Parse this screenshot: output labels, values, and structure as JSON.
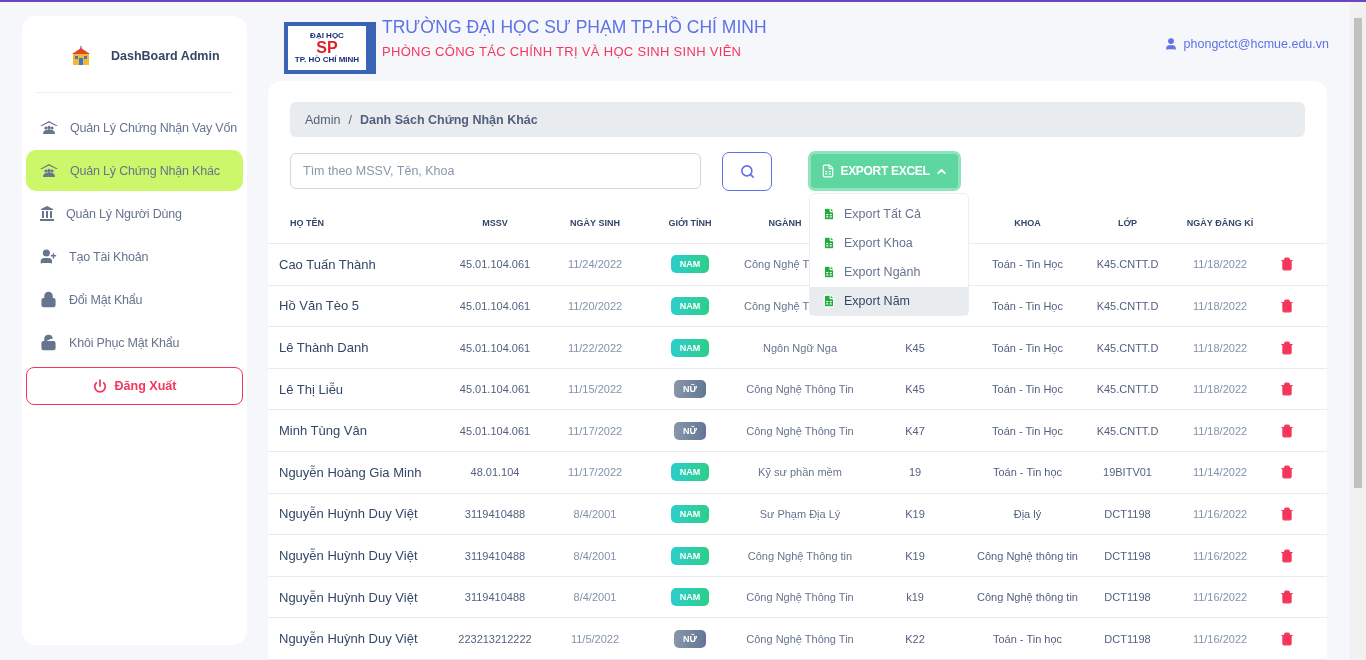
{
  "sidebar": {
    "title": "DashBoard Admin",
    "items": [
      {
        "label": "Quản Lý Chứng Nhận Vay Vốn",
        "kind": "roof",
        "selected": false
      },
      {
        "label": "Quản Lý Chứng Nhận Khác",
        "kind": "roof",
        "selected": true
      },
      {
        "label": "Quản Lý Người Dùng",
        "kind": "building",
        "selected": false
      },
      {
        "label": "Tạo Tài Khoản",
        "kind": "add-user",
        "selected": false
      },
      {
        "label": "Đổi Mật Khẩu",
        "kind": "lock",
        "selected": false
      },
      {
        "label": "Khôi Phục Mật Khẩu",
        "kind": "unlock",
        "selected": false
      }
    ],
    "logout": "Đăng Xuất"
  },
  "header": {
    "logo": {
      "top": "ĐẠI HỌC",
      "main": "SP",
      "bottom": "TP. HỒ CHÍ MINH"
    },
    "title": "TRƯỜNG ĐẠI HỌC SƯ PHẠM TP.HỒ CHÍ MINH",
    "subtitle": "PHÒNG CÔNG TÁC CHÍNH TRỊ VÀ HỌC SINH SINH VIÊN",
    "user": "phongctct@hcmue.edu.vn"
  },
  "breadcrumb": [
    "Admin",
    "/",
    "Danh Sách Chứng Nhận Khác"
  ],
  "search": {
    "placeholder": "Tìm theo MSSV, Tên, Khoa"
  },
  "export": {
    "label": "EXPORT EXCEL",
    "expanded": true,
    "items": [
      {
        "label": "Export Tất Cả",
        "selected": false
      },
      {
        "label": "Export Khoa",
        "selected": false
      },
      {
        "label": "Export Ngành",
        "selected": false
      },
      {
        "label": "Export Năm",
        "selected": true
      }
    ]
  },
  "table": {
    "columns": {
      "name": "HỌ TÊN",
      "mssv": "MSSV",
      "dob": "NGÀY SINH",
      "gender": "GIỚI TÍNH",
      "major": "NGÀNH",
      "faculty": "KHOA",
      "class": "LỚP",
      "registered": "NGÀY ĐĂNG KÍ"
    },
    "rows": [
      {
        "name": "Cao Tuấn Thành",
        "mssv": "45.01.104.061",
        "dob": "11/24/2022",
        "gender": {
          "label": "NAM",
          "kind": "male"
        },
        "major": "Công Nghệ T",
        "faculty": "Toán - Tin Học",
        "class": "K45.CNTT.D",
        "registered": "11/18/2022"
      },
      {
        "name": "Hồ Văn Tèo 5",
        "mssv": "45.01.104.061",
        "dob": "11/20/2022",
        "gender": {
          "label": "NAM",
          "kind": "male"
        },
        "major": "Công Nghệ T",
        "faculty": "Toán - Tin Học",
        "class": "K45.CNTT.D",
        "registered": "11/18/2022"
      },
      {
        "name": "Lê Thành Danh",
        "mssv": "45.01.104.061",
        "dob": "11/22/2022",
        "gender": {
          "label": "NAM",
          "kind": "male"
        },
        "major": "Ngôn Ngữ Nga",
        "column_6": "K45",
        "faculty": "Toán - Tin Học",
        "class": "K45.CNTT.D",
        "registered": "11/18/2022"
      },
      {
        "name": "Lê Thị Liễu",
        "mssv": "45.01.104.061",
        "dob": "11/15/2022",
        "gender": {
          "label": "NỮ",
          "kind": "female"
        },
        "major": "Công Nghệ Thông Tin",
        "column_6": "K45",
        "faculty": "Toán - Tin Học",
        "class": "K45.CNTT.D",
        "registered": "11/18/2022"
      },
      {
        "name": "Minh Tùng Vân",
        "mssv": "45.01.104.061",
        "dob": "11/17/2022",
        "gender": {
          "label": "NỮ",
          "kind": "female"
        },
        "major": "Công Nghệ Thông Tin",
        "column_6": "K47",
        "faculty": "Toán - Tin Học",
        "class": "K45.CNTT.D",
        "registered": "11/18/2022"
      },
      {
        "name": "Nguyễn Hoàng Gia Minh",
        "mssv": "48.01.104",
        "dob": "11/17/2022",
        "gender": {
          "label": "NAM",
          "kind": "male"
        },
        "major": "Kỹ sư phần mềm",
        "column_6": "19",
        "faculty": "Toán - Tin học",
        "class": "19BITV01",
        "registered": "11/14/2022"
      },
      {
        "name": "Nguyễn Huỳnh Duy Việt",
        "mssv": "3119410488",
        "dob": "8/4/2001",
        "gender": {
          "label": "NAM",
          "kind": "male"
        },
        "major": "Sư Phạm Địa Lý",
        "column_6": "K19",
        "faculty": "Địa lý",
        "class": "DCT1198",
        "registered": "11/16/2022"
      },
      {
        "name": "Nguyễn Huỳnh Duy Việt",
        "mssv": "3119410488",
        "dob": "8/4/2001",
        "gender": {
          "label": "NAM",
          "kind": "male"
        },
        "major": "Công Nghệ Thông tin",
        "column_6": "K19",
        "faculty": "Công Nghệ thông tin",
        "class": "DCT1198",
        "registered": "11/16/2022"
      },
      {
        "name": "Nguyễn Huỳnh Duy Việt",
        "mssv": "3119410488",
        "dob": "8/4/2001",
        "gender": {
          "label": "NAM",
          "kind": "male"
        },
        "major": "Công Nghệ Thông Tin",
        "column_6": "k19",
        "faculty": "Công Nghệ thông tin",
        "class": "DCT1198",
        "registered": "11/16/2022"
      },
      {
        "name": "Nguyễn Huỳnh Duy Việt",
        "mssv": "223213212222",
        "dob": "11/5/2022",
        "gender": {
          "label": "NỮ",
          "kind": "female"
        },
        "major": "Công Nghệ Thông Tin",
        "column_6": "K22",
        "faculty": "Toán - Tin học",
        "class": "DCT1198",
        "registered": "11/16/2022"
      }
    ]
  }
}
